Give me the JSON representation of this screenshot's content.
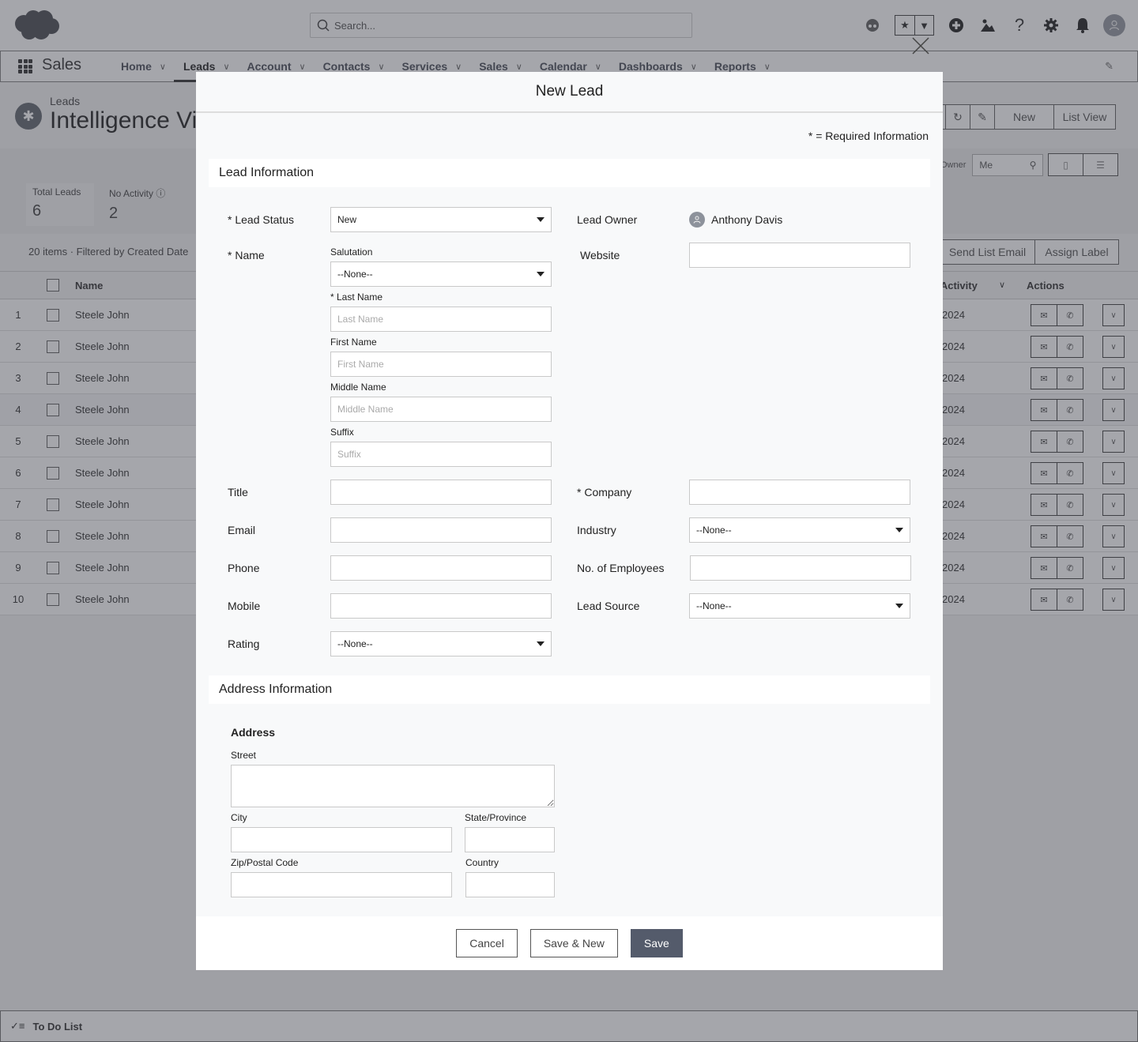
{
  "topbar": {
    "search_placeholder": "Search...",
    "icons": [
      "salesforce-cloud-logo",
      "search-icon",
      "astro-icon",
      "star-icon",
      "caret-down-icon",
      "add-icon",
      "trailhead-icon",
      "help-icon",
      "gear-icon",
      "bell-icon",
      "avatar-icon"
    ]
  },
  "nav": {
    "app_name": "Sales",
    "items": [
      {
        "label": "Home"
      },
      {
        "label": "Leads",
        "active": true
      },
      {
        "label": "Account"
      },
      {
        "label": "Contacts"
      },
      {
        "label": "Services"
      },
      {
        "label": "Sales"
      },
      {
        "label": "Calendar"
      },
      {
        "label": "Dashboards"
      },
      {
        "label": "Reports"
      }
    ]
  },
  "page": {
    "breadcrumb": "Leads",
    "title": "Intelligence View",
    "header_buttons": {
      "new": "New",
      "list_view": "List View"
    },
    "stats": [
      {
        "label": "Total Leads",
        "value": "6"
      },
      {
        "label": "No Activity",
        "value": "2"
      }
    ],
    "owner_label": "Owner",
    "owner_value": "Me",
    "list_info": "20 items  ·  Filtered by Created Date",
    "list_buttons": {
      "send_email": "Send List Email",
      "assign_label": "Assign Label"
    },
    "table": {
      "columns": {
        "name": "Name",
        "last_activity": "Last Activity",
        "actions": "Actions"
      },
      "rows": [
        {
          "num": "1",
          "name": "Steele John",
          "date": "2024"
        },
        {
          "num": "2",
          "name": "Steele John",
          "date": "2024"
        },
        {
          "num": "3",
          "name": "Steele John",
          "date": "2024"
        },
        {
          "num": "4",
          "name": "Steele John",
          "date": "2024"
        },
        {
          "num": "5",
          "name": "Steele John",
          "date": "2024"
        },
        {
          "num": "6",
          "name": "Steele John",
          "date": "2024"
        },
        {
          "num": "7",
          "name": "Steele John",
          "date": "2024"
        },
        {
          "num": "8",
          "name": "Steele John",
          "date": "2024"
        },
        {
          "num": "9",
          "name": "Steele John",
          "date": "2024"
        },
        {
          "num": "10",
          "name": "Steele John",
          "date": "2024"
        }
      ]
    }
  },
  "todo": {
    "label": "To Do List"
  },
  "modal": {
    "title": "New Lead",
    "required_note": "* = Required Information",
    "lead_section": "Lead Information",
    "address_section": "Address Information",
    "fields": {
      "lead_status": {
        "label": "* Lead Status",
        "value": "New"
      },
      "name": {
        "label": "* Name"
      },
      "salutation": {
        "label": "Salutation",
        "value": "--None--"
      },
      "last_name": {
        "label": "* Last Name",
        "placeholder": "Last Name"
      },
      "first_name": {
        "label": "First Name",
        "placeholder": "First Name"
      },
      "middle_name": {
        "label": "Middle Name",
        "placeholder": "Middle Name"
      },
      "suffix": {
        "label": "Suffix",
        "placeholder": "Suffix"
      },
      "title": {
        "label": "Title",
        "value": ""
      },
      "email": {
        "label": "Email",
        "value": ""
      },
      "phone": {
        "label": "Phone",
        "value": ""
      },
      "mobile": {
        "label": "Mobile",
        "value": ""
      },
      "rating": {
        "label": "Rating",
        "value": "--None--"
      },
      "lead_owner": {
        "label": "Lead Owner",
        "value": "Anthony Davis"
      },
      "website": {
        "label": "Website",
        "value": ""
      },
      "company": {
        "label": "* Company",
        "value": ""
      },
      "industry": {
        "label": "Industry",
        "value": "--None--"
      },
      "employees": {
        "label": "No. of Employees",
        "value": ""
      },
      "lead_source": {
        "label": "Lead Source",
        "value": "--None--"
      }
    },
    "address": {
      "title": "Address",
      "street": "Street",
      "city": "City",
      "state": "State/Province",
      "zip": "Zip/Postal Code",
      "country": "Country"
    },
    "buttons": {
      "cancel": "Cancel",
      "save_new": "Save & New",
      "save": "Save"
    }
  }
}
